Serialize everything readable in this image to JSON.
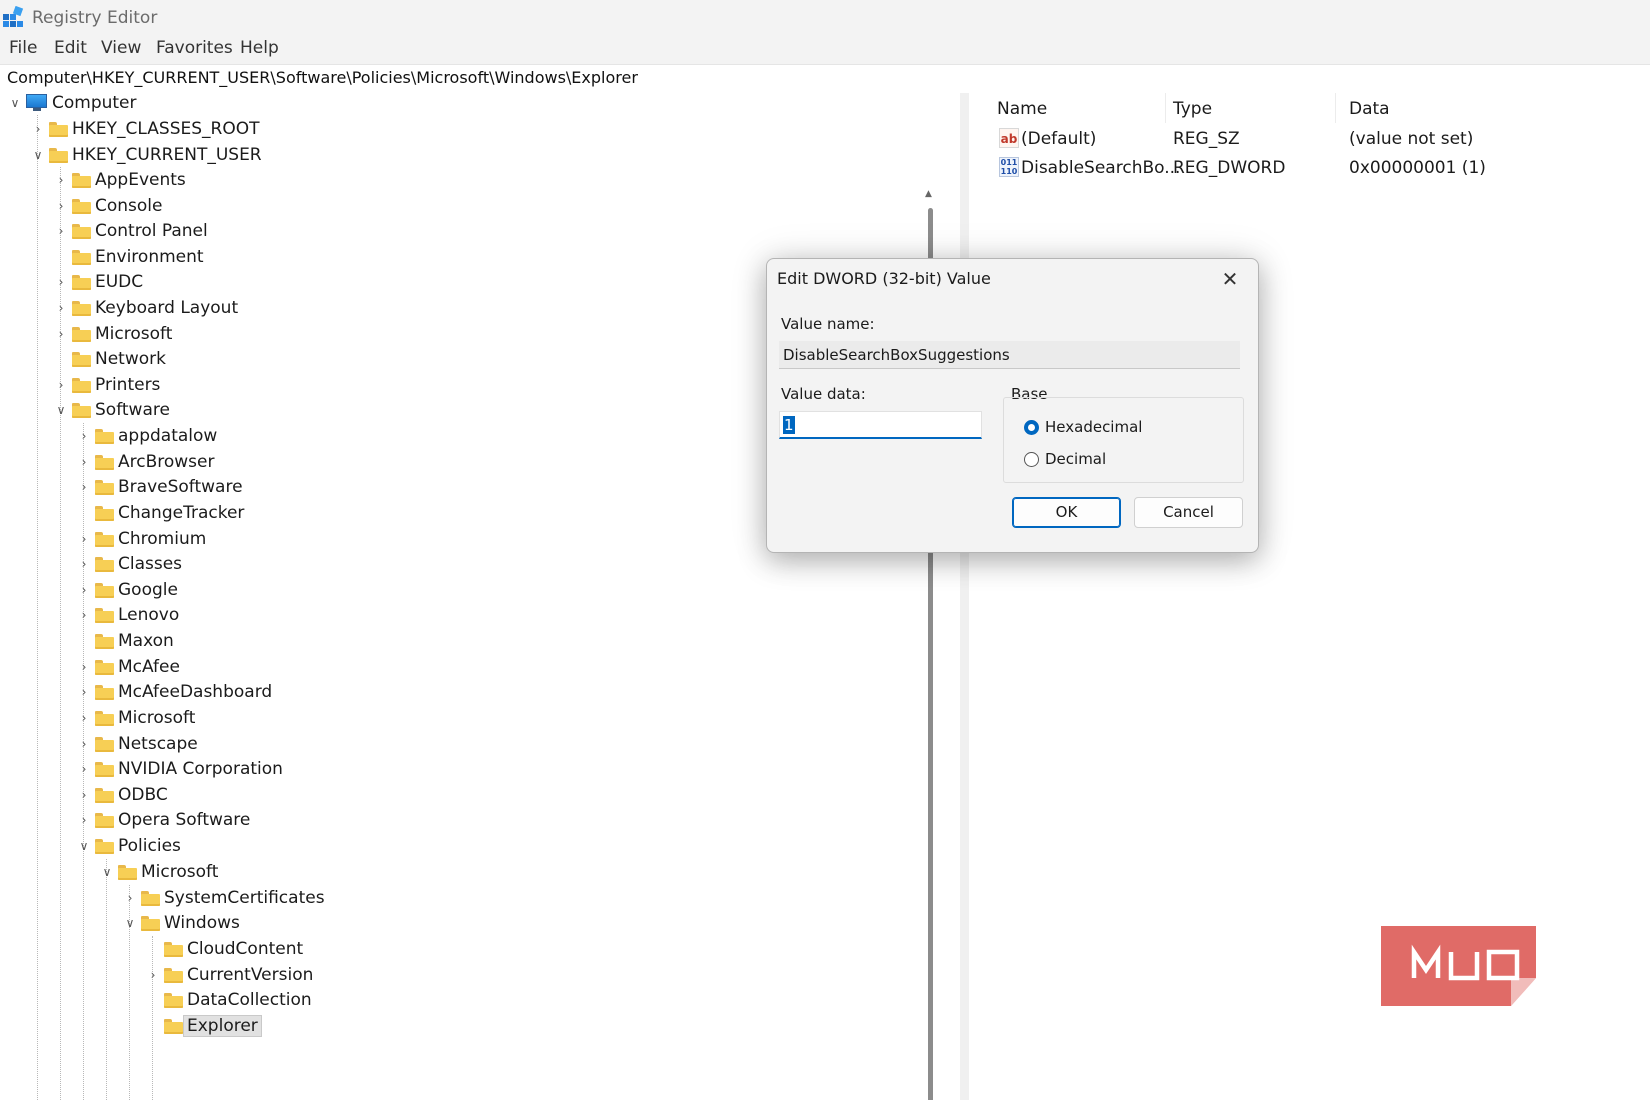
{
  "window": {
    "title": "Registry Editor"
  },
  "menu": [
    "File",
    "Edit",
    "View",
    "Favorites",
    "Help"
  ],
  "address": "Computer\\HKEY_CURRENT_USER\\Software\\Policies\\Microsoft\\Windows\\Explorer",
  "tree": {
    "root": "Computer",
    "hkcr": "HKEY_CLASSES_ROOT",
    "hkcu": "HKEY_CURRENT_USER",
    "hkcu_children": [
      "AppEvents",
      "Console",
      "Control Panel",
      "Environment",
      "EUDC",
      "Keyboard Layout",
      "Microsoft",
      "Network",
      "Printers",
      "Software"
    ],
    "software_children": [
      "appdatalow",
      "ArcBrowser",
      "BraveSoftware",
      "ChangeTracker",
      "Chromium",
      "Classes",
      "Google",
      "Lenovo",
      "Maxon",
      "McAfee",
      "McAfeeDashboard",
      "Microsoft",
      "Netscape",
      "NVIDIA Corporation",
      "ODBC",
      "Opera Software",
      "Policies"
    ],
    "policies_children": [
      "Microsoft"
    ],
    "policies_microsoft_children": [
      "SystemCertificates",
      "Windows"
    ],
    "windows_children": [
      "CloudContent",
      "CurrentVersion",
      "DataCollection",
      "Explorer"
    ],
    "selected": "Explorer"
  },
  "list": {
    "columns": [
      "Name",
      "Type",
      "Data"
    ],
    "rows": [
      {
        "name": "(Default)",
        "type": "REG_SZ",
        "data": "(value not set)",
        "icon": "string-value-icon"
      },
      {
        "name": "DisableSearchBo...",
        "type": "REG_DWORD",
        "data": "0x00000001 (1)",
        "icon": "binary-value-icon"
      }
    ]
  },
  "dialog": {
    "title": "Edit DWORD (32-bit) Value",
    "value_name_label": "Value name:",
    "value_name": "DisableSearchBoxSuggestions",
    "value_data_label": "Value data:",
    "value_data": "1",
    "base_label": "Base",
    "base_options": [
      "Hexadecimal",
      "Decimal"
    ],
    "base_selected": "Hexadecimal",
    "ok": "OK",
    "cancel": "Cancel"
  },
  "watermark": "MUO",
  "colors": {
    "accent": "#0067c0",
    "folder": "#f7cf55",
    "watermark": "#e06b67"
  }
}
